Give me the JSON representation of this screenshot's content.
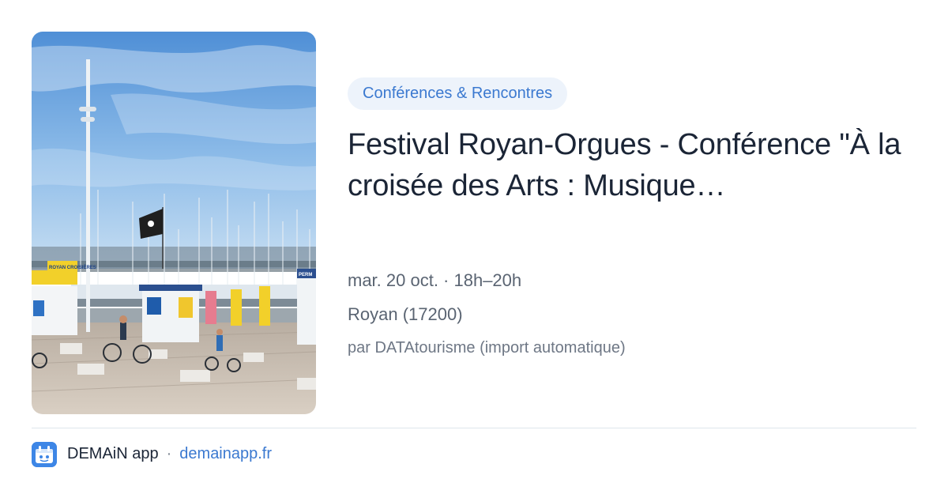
{
  "event": {
    "category": "Conférences & Rencontres",
    "title": "Festival Royan-Orgues - Conférence \"À la croisée des Arts : Musique…",
    "date_time": "mar. 20 oct. · 18h–20h",
    "location": "Royan (17200)",
    "source": "par DATAtourisme (import automatique)",
    "photo": {
      "sign_label": "ROYAN CROISIÈRES",
      "kiosk_label": "PERM"
    }
  },
  "footer": {
    "app_name": "DEMAiN app",
    "separator": "·",
    "domain": "demainapp.fr"
  },
  "colors": {
    "accent": "#3b79d0",
    "chip_bg": "#edf3fb",
    "logo_bg": "#3d86e6"
  }
}
